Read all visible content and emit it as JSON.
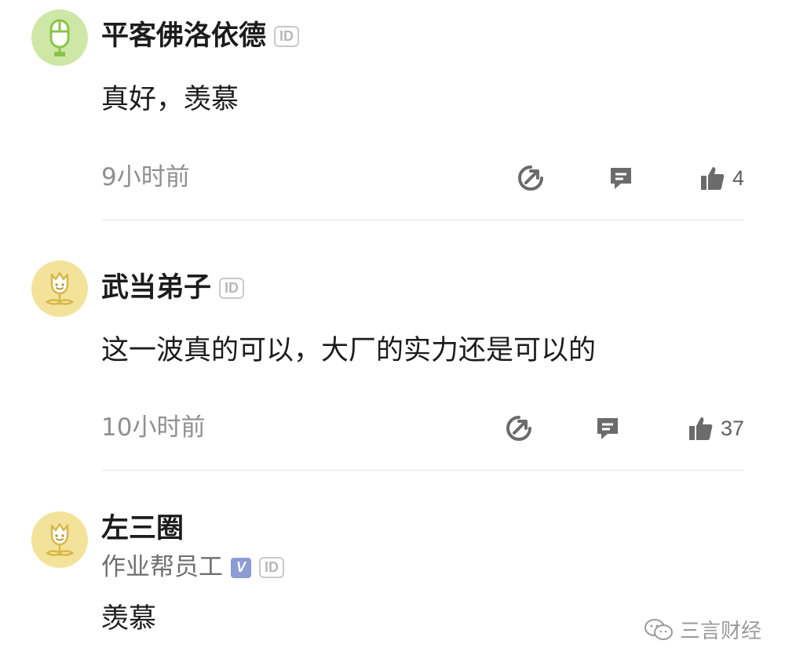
{
  "comments": [
    {
      "username": "平客佛洛依德",
      "id_badge": "ID",
      "avatar": "mouse-icon",
      "avatar_color": "#cfe7a6",
      "text": "真好，羡慕",
      "time": "9小时前",
      "likes": "4"
    },
    {
      "username": "武当弟子",
      "id_badge": "ID",
      "avatar": "tulip-icon",
      "avatar_color": "#f3e39a",
      "text": "这一波真的可以，大厂的实力还是可以的",
      "time": "10小时前",
      "likes": "37"
    },
    {
      "username": "左三圈",
      "id_badge": "ID",
      "subtitle": "作业帮员工",
      "verified_badge": "V",
      "avatar": "tulip-icon",
      "avatar_color": "#f3e39a",
      "text": "羡慕"
    }
  ],
  "watermark": {
    "text": "三言财经",
    "icon": "wechat-icon"
  },
  "colors": {
    "icon_gray": "#6b6b6b",
    "divider": "#e7e7e7",
    "verified": "#8d9bd6"
  }
}
